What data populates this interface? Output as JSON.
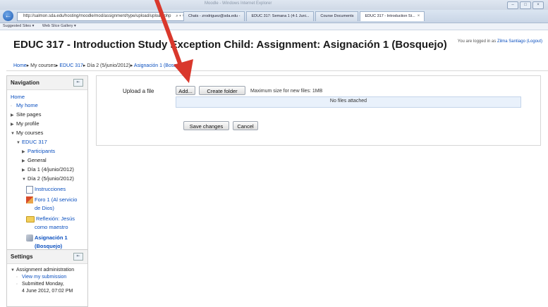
{
  "browser": {
    "window_title": "Moodle - Windows Internet Explorer",
    "address": "http://salmon.sda.edu/hosting/moodle/mod/assignment/type/upload/upload.php",
    "address_controls": "⌕ ▾ ×",
    "tabs": [
      {
        "label": "Chats - zrodriguez@sda.edu -"
      },
      {
        "label": "EDUC 317: Semana 1 (4-1 Juni..."
      },
      {
        "label": "Course Documents"
      },
      {
        "label": "EDUC 317 - Introduction St..."
      }
    ],
    "favorites": [
      "Suggested Sites ▾",
      "Web Slice Gallery ▾"
    ],
    "window_buttons": [
      "–",
      "□",
      "×"
    ]
  },
  "header": {
    "title": "EDUC 317 - Introduction Study Exception Child: Assignment: Asignación 1 (Bosquejo)",
    "login_prefix": "You are logged in as",
    "login_user": "Zilma Santiago",
    "logout": "(Logout)"
  },
  "breadcrumb": {
    "home": "Home",
    "courses": "My courses",
    "course": "EDUC 317",
    "section": "Día 2 (5/junio/2012)",
    "current": "Asignación 1 (Bosquejo)",
    "sep": "▸"
  },
  "navigation": {
    "title": "Navigation",
    "dock_icon": "⇤",
    "home": "Home",
    "my_home": "My home",
    "site_pages": "Site pages",
    "my_profile": "My profile",
    "my_courses": "My courses",
    "course": "EDUC 317",
    "participants": "Participants",
    "general": "General",
    "dia1": "Día 1 (4/junio/2012)",
    "dia2": "Día 2 (5/junio/2012)",
    "instrucciones": "Instrucciones",
    "foro1_a": "Foro 1 (Al servicio",
    "foro1_b": "de Dios)",
    "reflexion_a": "Reflexión: Jesús",
    "reflexion_b": "como maestro",
    "asignacion_a": "Asignación 1",
    "asignacion_b": "(Bosquejo)"
  },
  "settings": {
    "title": "Settings",
    "dock_icon": "⇤",
    "admin": "Assignment administration",
    "view_submission": "View my submission",
    "submitted_a": "Submitted Monday,",
    "submitted_b": "4 June 2012, 07:02 PM"
  },
  "form": {
    "upload_label": "Upload a file",
    "add_button": "Add...",
    "create_folder_button": "Create folder",
    "max_size": "Maximum size for new files: 1MB",
    "files_status": "No files attached",
    "save_button": "Save changes",
    "cancel_button": "Cancel"
  },
  "colors": {
    "link": "#0a4fbf",
    "annotation_arrow": "#d9382c"
  }
}
